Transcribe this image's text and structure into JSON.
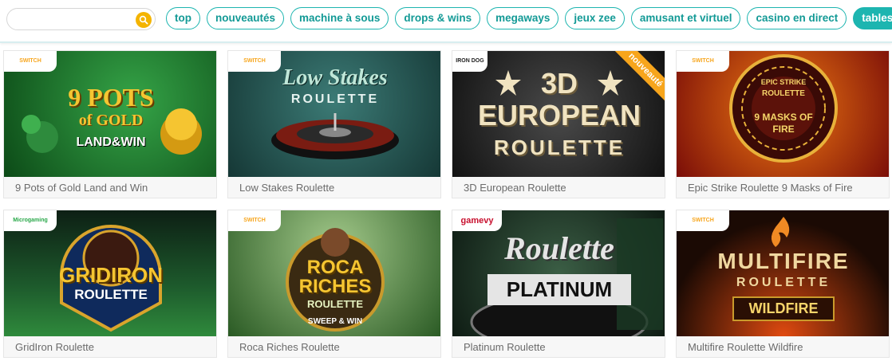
{
  "search": {
    "placeholder": ""
  },
  "filters": [
    {
      "label": "top",
      "active": false
    },
    {
      "label": "nouveautés",
      "active": false
    },
    {
      "label": "machine à sous",
      "active": false
    },
    {
      "label": "drops & wins",
      "active": false
    },
    {
      "label": "megaways",
      "active": false
    },
    {
      "label": "jeux zee",
      "active": false
    },
    {
      "label": "amusant et virtuel",
      "active": false
    },
    {
      "label": "casino en direct",
      "active": false
    },
    {
      "label": "tables",
      "active": true
    }
  ],
  "games": [
    {
      "name": "9 Pots of Gold Land and Win",
      "provider": "SWITCH",
      "art": [
        "9 POTS",
        "of GOLD",
        "LAND&WIN"
      ],
      "colors": [
        "#1f7a2f",
        "#0c4a17"
      ]
    },
    {
      "name": "Low Stakes Roulette",
      "provider": "SWITCH",
      "art": [
        "Low Stakes",
        "ROULETTE"
      ],
      "colors": [
        "#2f6a66",
        "#153735"
      ]
    },
    {
      "name": "3D European Roulette",
      "provider": "IRON DOG",
      "badge": "nouveauté",
      "art": [
        "3D",
        "EUROPEAN",
        "ROULETTE"
      ],
      "colors": [
        "#3a3a3a",
        "#141414"
      ]
    },
    {
      "name": "Epic Strike Roulette 9 Masks of Fire",
      "provider": "SWITCH",
      "art": [
        "EPIC STRIKE",
        "ROULETTE",
        "9 MASKS OF FIRE"
      ],
      "colors": [
        "#c3261a",
        "#6a0d08"
      ]
    },
    {
      "name": "GridIron Roulette",
      "provider": "Microgaming",
      "art": [
        "GRIDIRON",
        "ROULETTE"
      ],
      "colors": [
        "#1d5a2c",
        "#0b2a16"
      ]
    },
    {
      "name": "Roca Riches Roulette",
      "provider": "SWITCH",
      "art": [
        "ROCA",
        "RICHES",
        "ROULETTE",
        "SWEEP & WIN"
      ],
      "colors": [
        "#3f7d3a",
        "#1a3b1a"
      ]
    },
    {
      "name": "Platinum Roulette",
      "provider": "gamevy",
      "art": [
        "Roulette",
        "PLATINUM"
      ],
      "colors": [
        "#2f4a38",
        "#0e1b13"
      ]
    },
    {
      "name": "Multifire Roulette Wildfire",
      "provider": "SWITCH",
      "art": [
        "MULTIFIRE",
        "ROULETTE",
        "WILDFIRE"
      ],
      "colors": [
        "#5a2a10",
        "#1b0a04"
      ]
    }
  ]
}
